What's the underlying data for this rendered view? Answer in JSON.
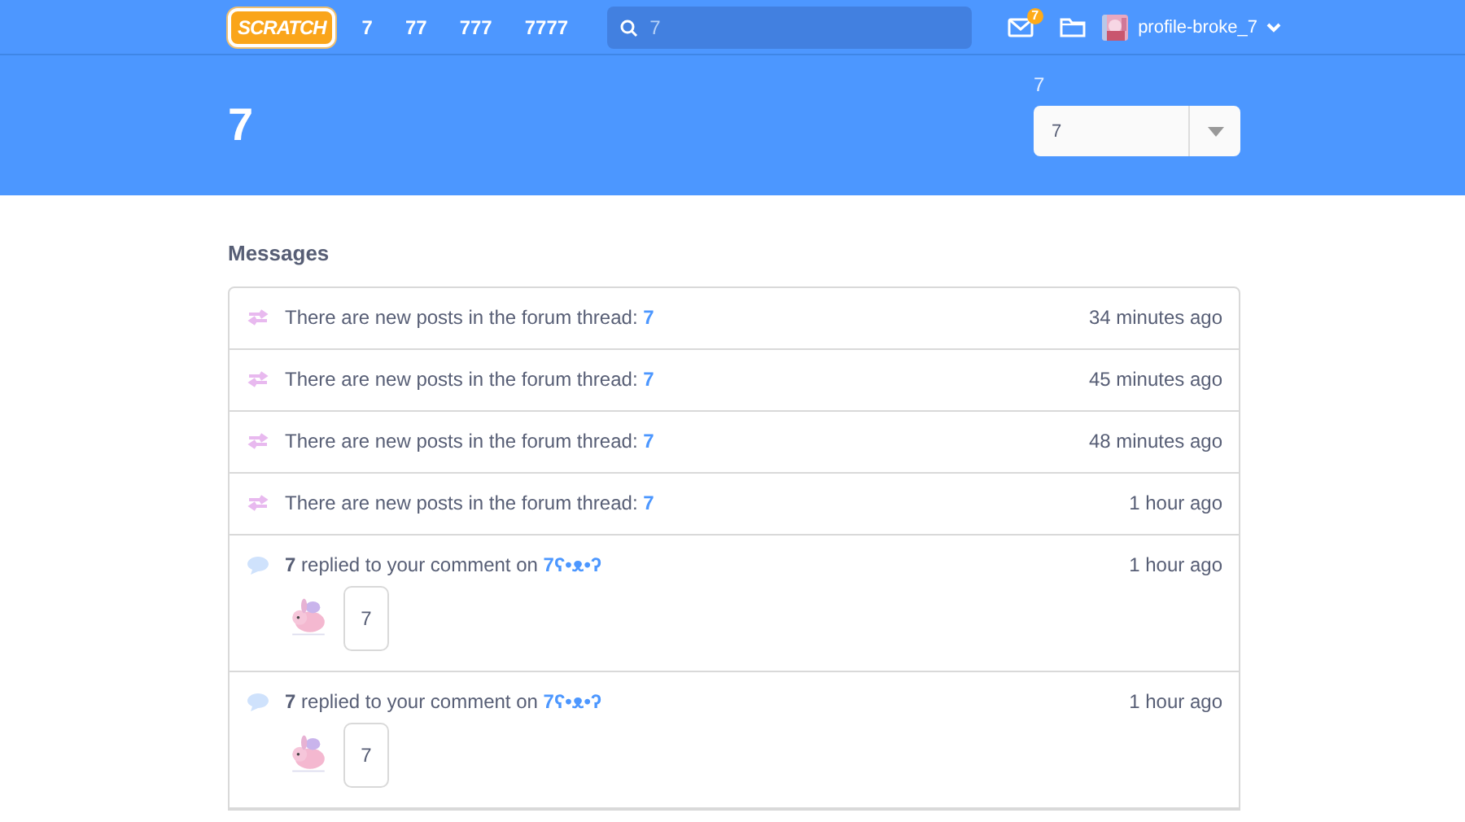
{
  "nav": {
    "logo": "SCRATCH",
    "links": [
      "7",
      "77",
      "777",
      "7777"
    ],
    "search": {
      "placeholder": "7"
    },
    "message_count": "7",
    "username": "profile-broke_7"
  },
  "header": {
    "title": "7",
    "filter": {
      "label": "7",
      "value": "7"
    }
  },
  "messages_title": "Messages",
  "messages": [
    {
      "kind": "forum",
      "text": "There are new posts in the forum thread: ",
      "link": "7",
      "time": "34 minutes ago"
    },
    {
      "kind": "forum",
      "text": "There are new posts in the forum thread: ",
      "link": "7",
      "time": "45 minutes ago"
    },
    {
      "kind": "forum",
      "text": "There are new posts in the forum thread: ",
      "link": "7",
      "time": "48 minutes ago"
    },
    {
      "kind": "forum",
      "text": "There are new posts in the forum thread: ",
      "link": "7",
      "time": "1 hour ago"
    },
    {
      "kind": "comment",
      "user": "7",
      "text": " replied to your comment on ",
      "link": "7ʕ•ᴥ•ʔ",
      "time": "1 hour ago",
      "comment": "7"
    },
    {
      "kind": "comment",
      "user": "7",
      "text": " replied to your comment on ",
      "link": "7ʕ•ᴥ•ʔ",
      "time": "1 hour ago",
      "comment": "7"
    }
  ]
}
